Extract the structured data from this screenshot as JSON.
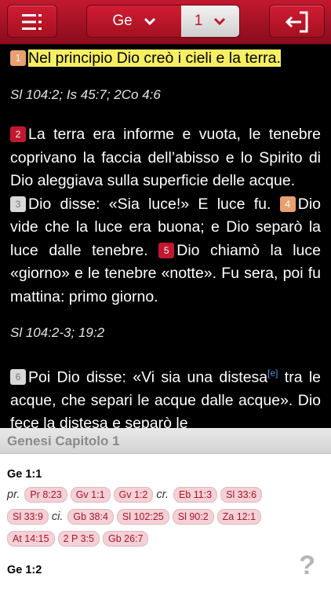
{
  "toolbar": {
    "menu_icon": "list-menu-icon",
    "book": "Ge",
    "chapter": "1",
    "back_icon": "exit-icon",
    "accent": "#c2182f"
  },
  "verses": {
    "v1": {
      "num": "1",
      "text": "Nel principio Dio creò i cieli e la terra."
    },
    "ref1": "Sl 104:2; Is 45:7; 2Co 4:6",
    "v2": {
      "num": "2",
      "text": "La terra era informe e vuota, le tenebre coprivano la faccia dell’abisso e lo Spirito di Dio aleggiava sulla superficie delle acque."
    },
    "v3": {
      "num": "3",
      "text": "Dio disse: «Sia luce!» E luce fu."
    },
    "v4": {
      "num": "4",
      "text": "Dio vide che la luce era buona; e Dio separò la luce dalle tenebre."
    },
    "v5": {
      "num": "5",
      "text": "Dio chiamò la luce «giorno» e le tenebre «notte». Fu sera, poi fu mattina: primo giorno."
    },
    "ref2": "Sl 104:2-3; 19:2",
    "v6": {
      "num": "6",
      "text": "Poi Dio disse: «Vi sia una distesa",
      "footnote": "[e]",
      "text_after": " tra le acque, che separi le acque dalle acque». Dio fece la distesa e separò le"
    }
  },
  "panel": {
    "title": "Genesi Capitolo 1",
    "sections": [
      {
        "heading": "Ge 1:1",
        "rows": [
          {
            "label": "pr.",
            "chips": [
              "Pr 8:23",
              "Gv 1:1",
              "Gv 1:2"
            ],
            "label2": "cr.",
            "chips2": [
              "Eb 11:3",
              "Sl 33:6"
            ]
          },
          {
            "chips": [
              "Sl 33:9"
            ],
            "label2": "ci.",
            "chips2": [
              "Gb 38:4",
              "Sl 102:25",
              "Sl 90:2",
              "Za 12:1"
            ]
          },
          {
            "chips": [
              "At 14:15",
              "2 P 3:5",
              "Gb 26:7"
            ]
          }
        ]
      },
      {
        "heading": "Ge 1:2"
      }
    ],
    "help": "?"
  }
}
